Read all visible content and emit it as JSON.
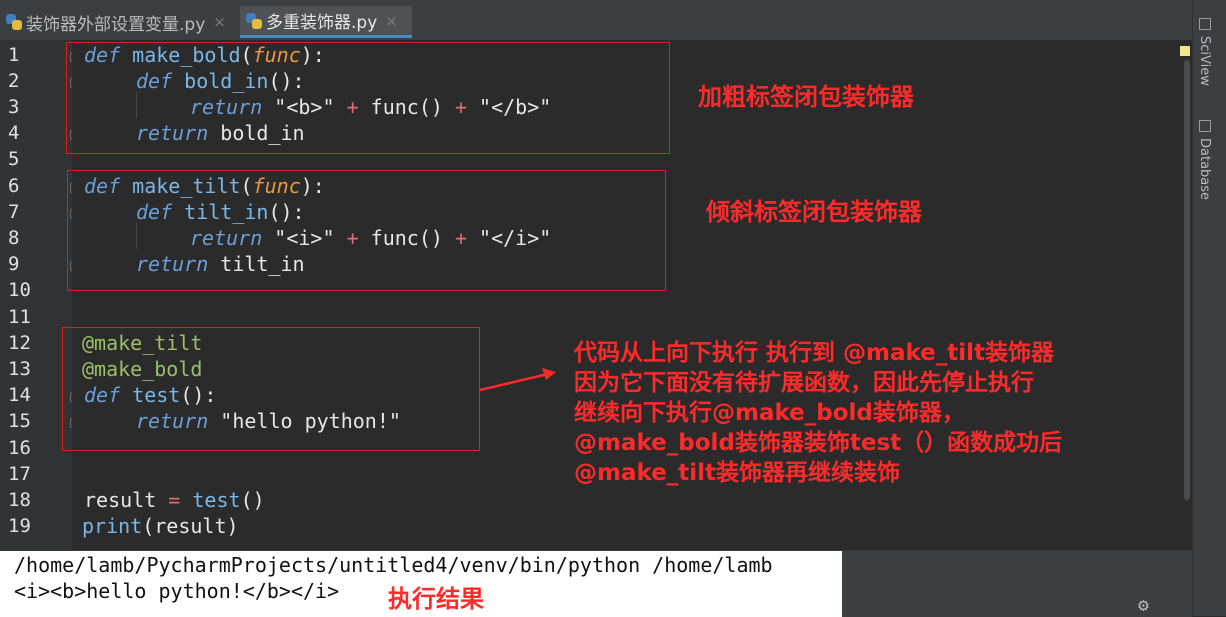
{
  "tabs": [
    {
      "label": "装饰器外部设置变量.py",
      "active": false
    },
    {
      "label": "多重装饰器.py",
      "active": true
    }
  ],
  "tab_close_glyph": "×",
  "right_panel": {
    "sciview_label": "SciView",
    "database_label": "Database"
  },
  "line_numbers": [
    "1",
    "2",
    "3",
    "4",
    "5",
    "6",
    "7",
    "8",
    "9",
    "10",
    "11",
    "12",
    "13",
    "14",
    "15",
    "16",
    "17",
    "18",
    "19"
  ],
  "code": {
    "l1": {
      "kw": "def",
      "name": "make_bold",
      "open": "(",
      "param": "func",
      "close": "):"
    },
    "l2": {
      "kw": "def",
      "name": "bold_in",
      "paren": "():"
    },
    "l3": {
      "kw": "return",
      "s1": "\"<b>\"",
      "plus1": "+",
      "call": "func()",
      "plus2": "+",
      "s2": "\"</b>\""
    },
    "l4": {
      "kw": "return",
      "rest": "bold_in"
    },
    "l6": {
      "kw": "def",
      "name": "make_tilt",
      "open": "(",
      "param": "func",
      "close": "):"
    },
    "l7": {
      "kw": "def",
      "name": "tilt_in",
      "paren": "():"
    },
    "l8": {
      "kw": "return",
      "s1": "\"<i>\"",
      "plus1": "+",
      "call": "func()",
      "plus2": "+",
      "s2": "\"</i>\""
    },
    "l9": {
      "kw": "return",
      "rest": "tilt_in"
    },
    "l12": {
      "dec": "@make_tilt"
    },
    "l13": {
      "dec": "@make_bold"
    },
    "l14": {
      "kw": "def",
      "name": "test",
      "paren": "():"
    },
    "l15": {
      "kw": "return",
      "str": "\"hello python!\""
    },
    "l18": {
      "var": "result",
      "eq": "=",
      "call": "test",
      "paren": "()"
    },
    "l19": {
      "fn": "print",
      "args": "(result)"
    }
  },
  "annotations": {
    "bold_note": "加粗标签闭包装饰器",
    "tilt_note": "倾斜标签闭包装饰器",
    "order_note": [
      "代码从上向下执行 执行到 @make_tilt装饰器",
      "因为它下面没有待扩展函数，因此先停止执行",
      "继续向下执行@make_bold装饰器，",
      "@make_bold装饰器装饰test（）函数成功后",
      "@make_tilt装饰器再继续装饰"
    ],
    "result_note": "执行结果"
  },
  "run_output": {
    "command": "/home/lamb/PycharmProjects/untitled4/venv/bin/python /home/lamb",
    "result": "<i><b>hello python!</b></i>"
  },
  "colors": {
    "annotation": "#ff2a2a",
    "editor_bg": "#2b2b2b"
  }
}
